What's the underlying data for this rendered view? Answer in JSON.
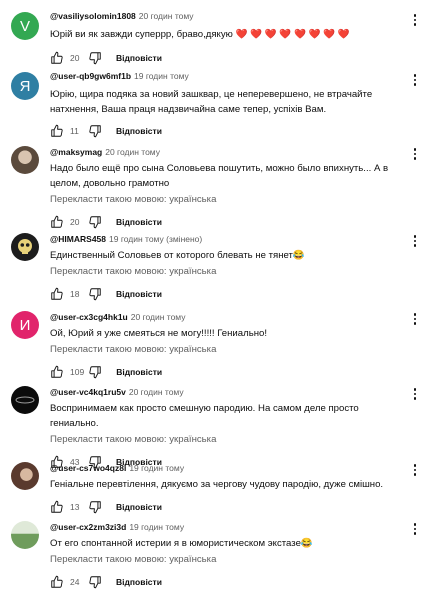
{
  "ui": {
    "reply_label": "Відповісти",
    "translate_label": "Перекласти такою мовою: українська"
  },
  "comments": [
    {
      "avatar_letter": "V",
      "avatar_color": "#33a852",
      "author": "@vasiliysolomin1808",
      "time": "20 годин тому",
      "text": "Юрій ви як завжди суперрр, браво,дякую ❤️ ❤️ ❤️ ❤️ ❤️ ❤️ ❤️ ❤️",
      "likes": "20"
    },
    {
      "avatar_letter": "Я",
      "avatar_color": "#2f7fa3",
      "author": "@user-qb9gw6mf1b",
      "time": "19 годин тому",
      "text": "Юрію, щира подяка за новий зашквар, це неперевершено, не втрачайте натхнення, Ваша праця надзвичайна саме тепер, успіхів Вам.",
      "likes": "11"
    },
    {
      "avatar_letter": "",
      "avatar_color": "#7a6a5a",
      "author": "@maksymag",
      "time": "20 годин тому",
      "text": "Надо было ещё про сына Соловьева пошутить, можно было впихнуть... А в целом, довольно грамотно",
      "translate": true,
      "likes": "20"
    },
    {
      "avatar_letter": "",
      "avatar_color": "#1d1d1d",
      "author": "@HIMARS458",
      "time": "19 годин тому (змінено)",
      "text": "Единственный Соловьев от которого блевать не тянет😂",
      "translate": true,
      "likes": "18"
    },
    {
      "avatar_letter": "И",
      "avatar_color": "#e1246b",
      "author": "@user-cx3cg4hk1u",
      "time": "20 годин тому",
      "text": "Ой, Юрий я уже смеяться не могу!!!!! Гениально!",
      "translate": true,
      "likes": "109"
    },
    {
      "avatar_letter": "",
      "avatar_color": "#0b0b0b",
      "author": "@user-vc4kq1ru5v",
      "time": "20 годин тому",
      "text": "Воспринимаем как просто смешную пародию. На самом деле просто гениально.",
      "translate": true,
      "likes": "43"
    },
    {
      "avatar_letter": "",
      "avatar_color": "#8a5a48",
      "author": "@user-cs7wo4qz8i",
      "time": "19 годин тому",
      "text": "Геніальне перевтілення, дякуємо за чергову чудову пародію, дуже смішно.",
      "likes": "13"
    },
    {
      "avatar_letter": "",
      "avatar_color": "#c9d9c2",
      "author": "@user-cx2zm3zi3d",
      "time": "19 годин тому",
      "text": "От его спонтанной истерии я в юмористическом экстазе😂",
      "translate": true,
      "likes": "24"
    }
  ]
}
